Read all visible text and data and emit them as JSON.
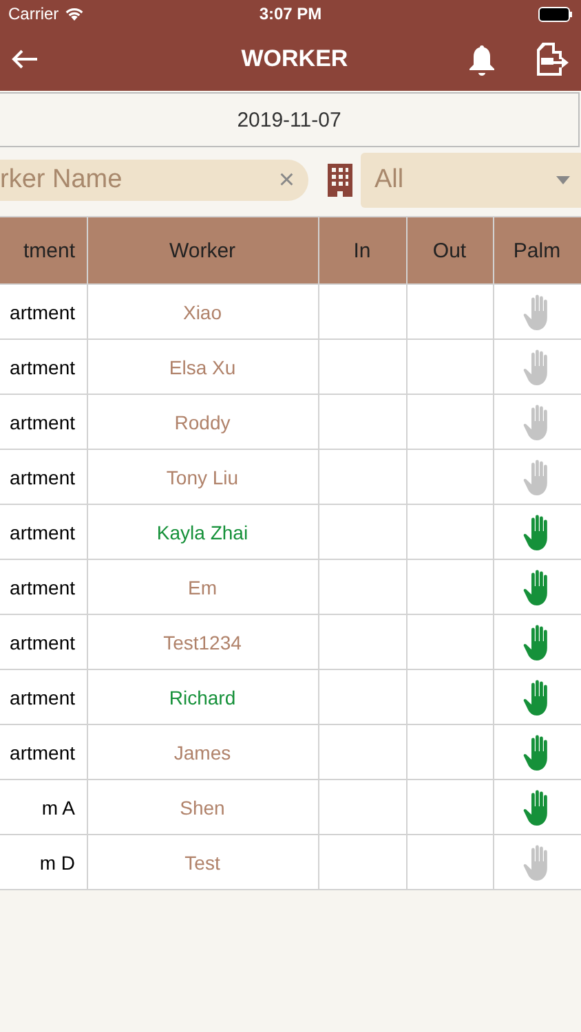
{
  "status_bar": {
    "carrier": "Carrier",
    "time": "3:07 PM"
  },
  "nav": {
    "title": "WORKER"
  },
  "date": "2019-11-07",
  "search": {
    "placeholder": "rker Name",
    "clear": "×"
  },
  "filter": {
    "value": "All"
  },
  "table": {
    "columns": [
      "tment",
      "Worker",
      "In",
      "Out",
      "Palm"
    ],
    "rows": [
      {
        "department": "artment",
        "worker": "Xiao",
        "name_highlighted": false,
        "palm_scanned": false
      },
      {
        "department": "artment",
        "worker": "Elsa Xu",
        "name_highlighted": false,
        "palm_scanned": false
      },
      {
        "department": "artment",
        "worker": "Roddy",
        "name_highlighted": false,
        "palm_scanned": false
      },
      {
        "department": "artment",
        "worker": "Tony Liu",
        "name_highlighted": false,
        "palm_scanned": false
      },
      {
        "department": "artment",
        "worker": "Kayla Zhai",
        "name_highlighted": true,
        "palm_scanned": true
      },
      {
        "department": "artment",
        "worker": "Em",
        "name_highlighted": false,
        "palm_scanned": true
      },
      {
        "department": "artment",
        "worker": "Test1234",
        "name_highlighted": false,
        "palm_scanned": true
      },
      {
        "department": "artment",
        "worker": "Richard",
        "name_highlighted": true,
        "palm_scanned": true
      },
      {
        "department": "artment",
        "worker": "James",
        "name_highlighted": false,
        "palm_scanned": true
      },
      {
        "department": "m A",
        "worker": "Shen",
        "name_highlighted": false,
        "palm_scanned": true
      },
      {
        "department": "m D",
        "worker": "Test",
        "name_highlighted": false,
        "palm_scanned": false
      }
    ]
  }
}
